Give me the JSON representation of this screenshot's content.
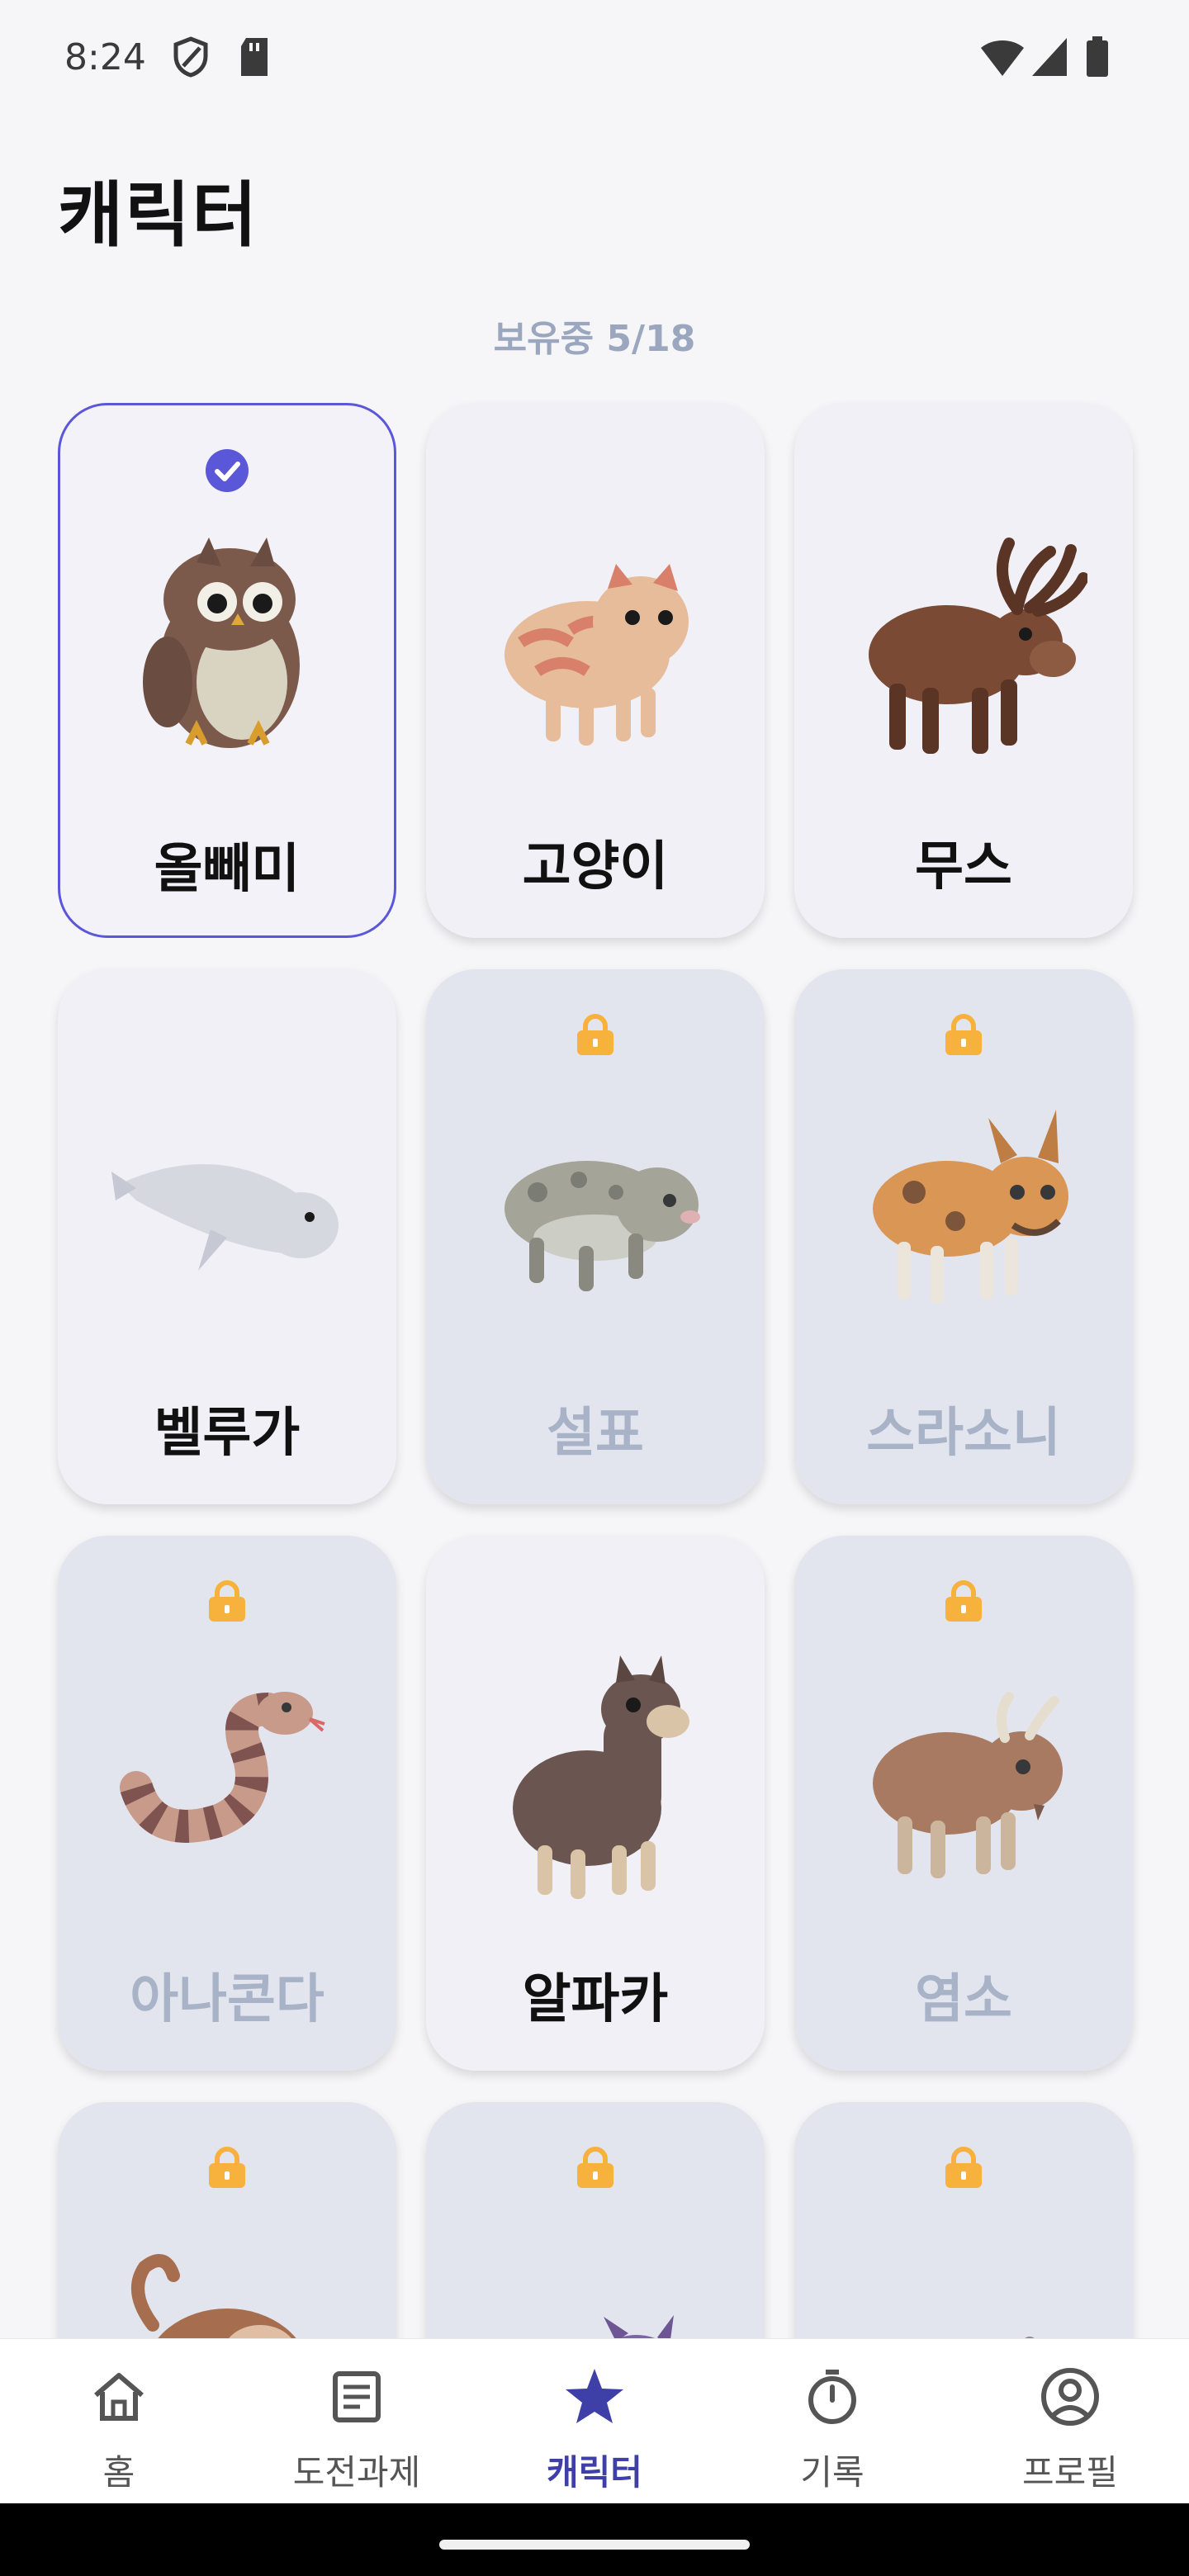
{
  "status_bar": {
    "time": "8:24"
  },
  "header": {
    "title": "캐릭터",
    "owned_label": "보유중 5/18"
  },
  "colors": {
    "accent": "#5b57d9",
    "lock": "#f6b23c",
    "locked_text": "#a9b3c8"
  },
  "characters": [
    {
      "name": "올빼미",
      "owned": true,
      "selected": true
    },
    {
      "name": "고양이",
      "owned": true
    },
    {
      "name": "무스",
      "owned": true
    },
    {
      "name": "벨루가",
      "owned": true
    },
    {
      "name": "설표",
      "owned": false
    },
    {
      "name": "스라소니",
      "owned": false
    },
    {
      "name": "아나콘다",
      "owned": false
    },
    {
      "name": "알파카",
      "owned": true
    },
    {
      "name": "염소",
      "owned": false
    },
    {
      "name": "",
      "owned": false
    },
    {
      "name": "",
      "owned": false
    },
    {
      "name": "",
      "owned": false
    }
  ],
  "nav": {
    "home": "홈",
    "challenges": "도전과제",
    "characters": "캐릭터",
    "records": "기록",
    "profile": "프로필",
    "active": "characters"
  }
}
